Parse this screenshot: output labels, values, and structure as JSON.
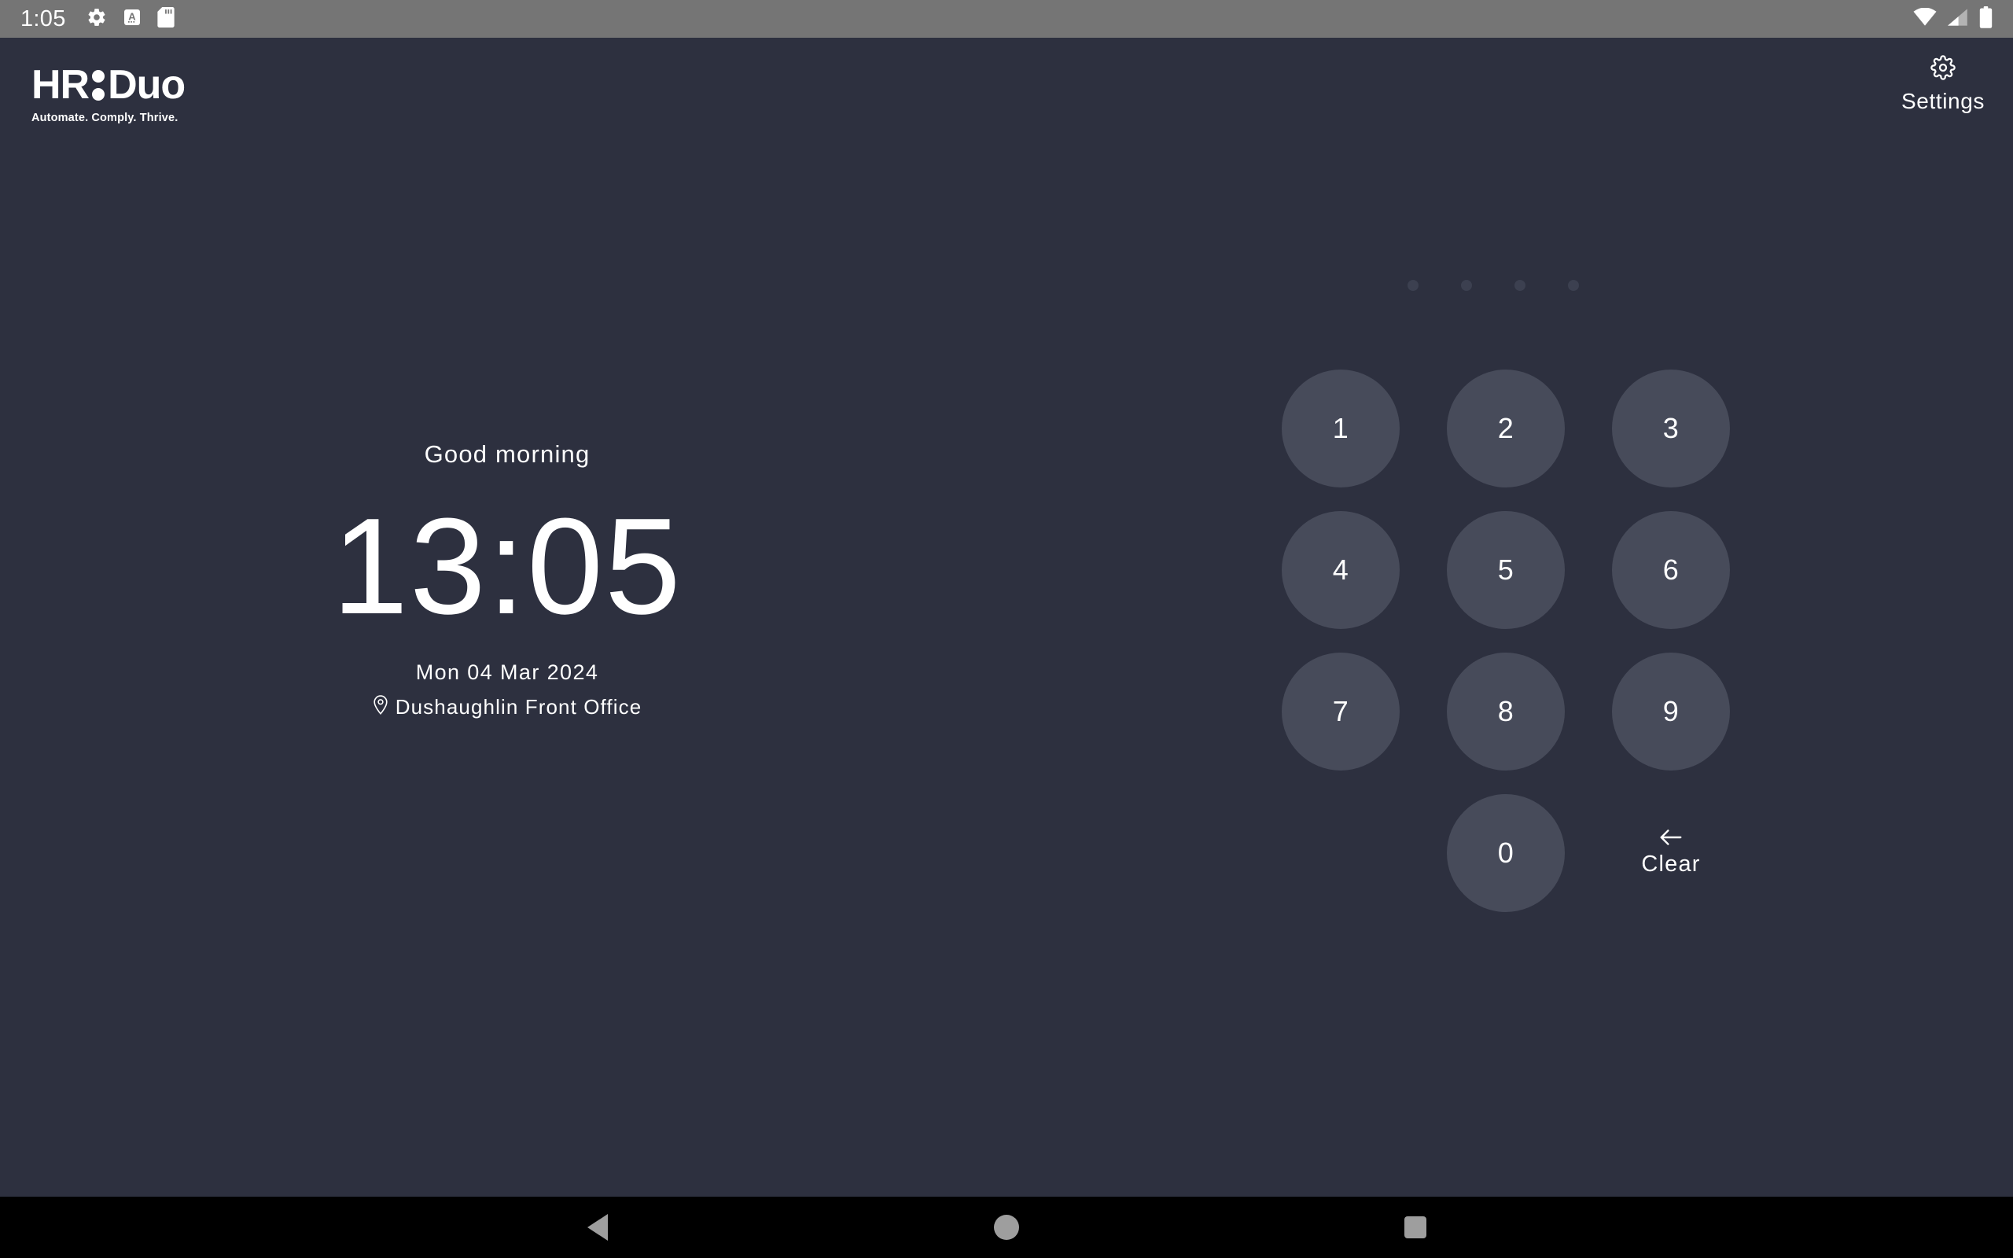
{
  "statusbar": {
    "time": "1:05",
    "left_icons": [
      "gear-icon",
      "keyboard-language-icon",
      "sd-card-icon"
    ],
    "right_icons": [
      "wifi-icon",
      "cellular-signal-icon",
      "battery-icon"
    ],
    "background_color": "#757575"
  },
  "brand": {
    "name_part1": "HR",
    "name_part2": "Duo",
    "tagline": "Automate. Comply. Thrive."
  },
  "settings": {
    "label": "Settings",
    "icon": "gear-icon"
  },
  "info": {
    "greeting": "Good morning",
    "time": "13:05",
    "date": "Mon 04 Mar 2024",
    "location": "Dushaughlin Front Office",
    "location_icon": "map-pin-icon"
  },
  "pin": {
    "length": 4,
    "entered": 0,
    "dots": [
      "",
      "",
      "",
      ""
    ]
  },
  "keypad": {
    "keys": [
      "1",
      "2",
      "3",
      "4",
      "5",
      "6",
      "7",
      "8",
      "9"
    ],
    "zero": "0",
    "clear_label": "Clear",
    "clear_icon": "arrow-left-icon",
    "key_color": "#474b5a"
  },
  "navbar": {
    "back": "back-triangle",
    "home": "home-circle",
    "recents": "recents-square"
  },
  "theme": {
    "background": "#2d303f",
    "text": "#ffffff",
    "navbar": "#000000"
  }
}
